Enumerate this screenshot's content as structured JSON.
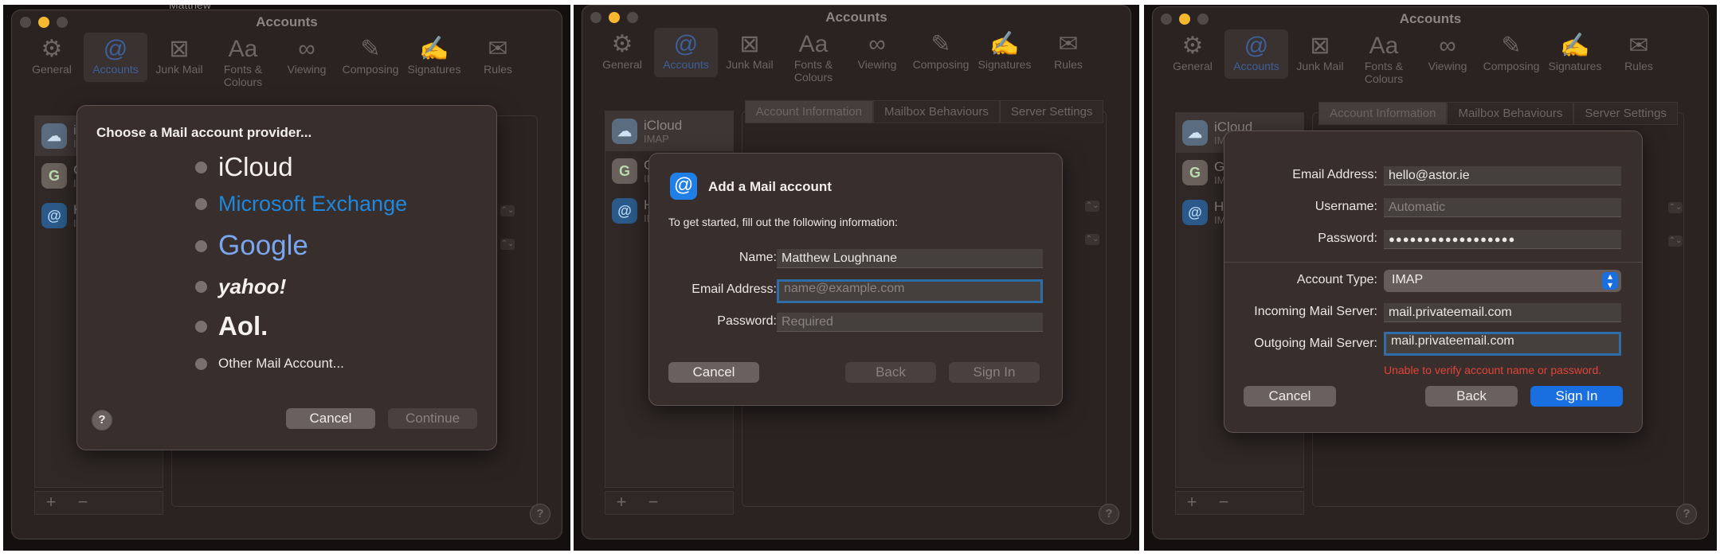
{
  "window": {
    "title": "Accounts",
    "toolbar": [
      {
        "label": "General",
        "icon": "gear-icon",
        "glyph": "⚙"
      },
      {
        "label": "Accounts",
        "icon": "at-icon",
        "glyph": "@"
      },
      {
        "label": "Junk Mail",
        "icon": "junk-mail-icon",
        "glyph": "⊠"
      },
      {
        "label": "Fonts & Colours",
        "icon": "fonts-icon",
        "glyph": "Aa"
      },
      {
        "label": "Viewing",
        "icon": "glasses-icon",
        "glyph": "∞"
      },
      {
        "label": "Composing",
        "icon": "compose-icon",
        "glyph": "✎"
      },
      {
        "label": "Signatures",
        "icon": "signature-icon",
        "glyph": "✍"
      },
      {
        "label": "Rules",
        "icon": "rules-icon",
        "glyph": "✉"
      }
    ],
    "tabs": [
      "Account Information",
      "Mailbox Behaviours",
      "Server Settings"
    ],
    "sidebar": {
      "accounts": [
        {
          "name": "iCloud",
          "type": "IMAP",
          "icon": "icloud-icon",
          "glyph": "☁"
        },
        {
          "name": "G",
          "type": "IM",
          "icon": "google-icon",
          "glyph": "G"
        },
        {
          "name": "H",
          "type": "IM",
          "icon": "at-icon",
          "glyph": "@"
        }
      ],
      "add": "+",
      "remove": "−"
    },
    "help": "?",
    "top_fragment": "Matthew",
    "stepper": "⌃⌄"
  },
  "panel1": {
    "heading": "Choose a Mail account provider...",
    "providers": [
      "iCloud",
      "Microsoft Exchange",
      "Google",
      "yahoo!",
      "Aol.",
      "Other Mail Account..."
    ],
    "cancel": "Cancel",
    "continue": "Continue",
    "help": "?"
  },
  "panel2": {
    "title": "Add a Mail account",
    "intro": "To get started, fill out the following information:",
    "name_label": "Name:",
    "name_value": "Matthew Loughnane",
    "email_label": "Email Address:",
    "email_placeholder": "name@example.com",
    "password_label": "Password:",
    "password_placeholder": "Required",
    "cancel": "Cancel",
    "back": "Back",
    "signin": "Sign In"
  },
  "panel3": {
    "email_label": "Email Address:",
    "email_value": "hello@astor.ie",
    "username_label": "Username:",
    "username_placeholder": "Automatic",
    "password_label": "Password:",
    "password_value": "●●●●●●●●●●●●●●●●●●",
    "type_label": "Account Type:",
    "type_value": "IMAP",
    "incoming_label": "Incoming Mail Server:",
    "incoming_value": "mail.privateemail.com",
    "outgoing_label": "Outgoing Mail Server:",
    "outgoing_value": "mail.privateemail.com",
    "error": "Unable to verify account name or password.",
    "cancel": "Cancel",
    "back": "Back",
    "signin": "Sign In"
  },
  "colors": {
    "accent": "#1a6fe0",
    "error": "#e0443a",
    "background": "#2a2322"
  }
}
